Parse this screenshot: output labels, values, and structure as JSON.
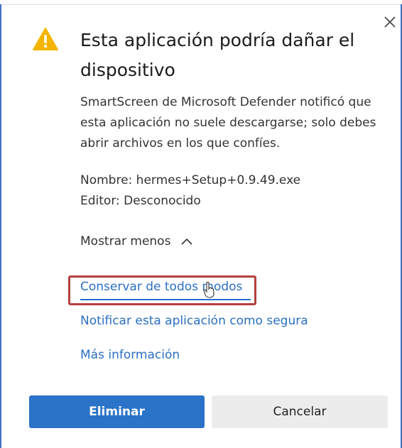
{
  "dialog": {
    "title": "Esta aplicación podría dañar el dispositivo",
    "body": "SmartScreen de Microsoft Defender notificó que esta aplicación no suele descargarse; solo debes abrir archivos en los que confíes.",
    "name_line": "Nombre: hermes+Setup+0.9.49.exe",
    "publisher_line": "Editor: Desconocido",
    "toggle_label": "Mostrar menos",
    "links": {
      "keep": "Conservar de todos modos",
      "report": "Notificar esta aplicación como segura",
      "more": "Más información"
    },
    "buttons": {
      "delete": "Eliminar",
      "cancel": "Cancelar"
    }
  },
  "icons": {
    "close": "close-icon",
    "warning": "warning-icon",
    "toggle": "chevron-up-icon",
    "cursor": "hand-cursor-icon"
  },
  "colors": {
    "warning": "#f4b400",
    "link": "#2b6fc4",
    "primary": "#2a73c8",
    "highlight": "#b5403c"
  }
}
